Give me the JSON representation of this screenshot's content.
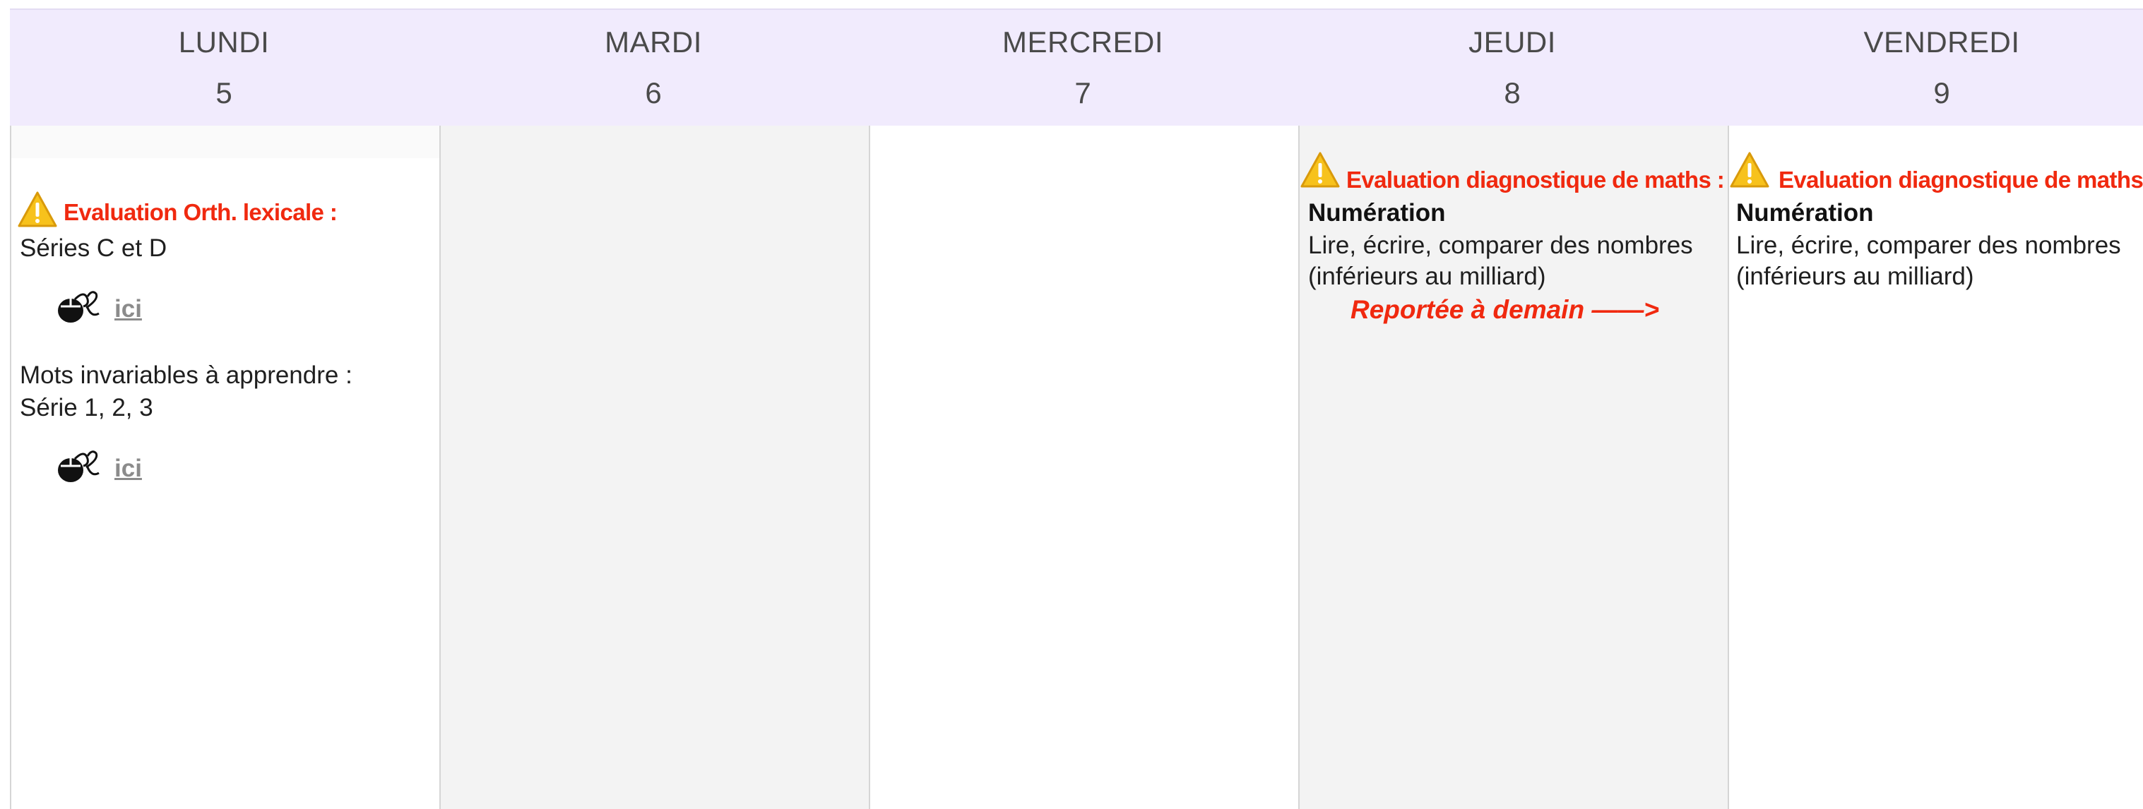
{
  "days": [
    {
      "name": "LUNDI",
      "num": "5"
    },
    {
      "name": "MARDI",
      "num": "6"
    },
    {
      "name": "MERCREDI",
      "num": "7"
    },
    {
      "name": "JEUDI",
      "num": "8"
    },
    {
      "name": "VENDREDI",
      "num": "9"
    }
  ],
  "lundi": {
    "event_title": "Evaluation Orth. lexicale :",
    "series_text": "Séries C et D",
    "link1": "ici",
    "mots_line1": "Mots invariables à apprendre :",
    "mots_line2": "Série 1, 2, 3",
    "link2": "ici",
    "icon_warning": "warning-icon",
    "icon_mouse": "mouse-icon"
  },
  "jeudi": {
    "event_title": "Evaluation diagnostique de maths :",
    "subject": "Numération",
    "line1": "Lire, écrire, comparer des nombres",
    "line2": "(inférieurs au milliard)",
    "reported": "Reportée à demain ——>"
  },
  "vendredi": {
    "event_title": "Evaluation diagnostique de maths :",
    "subject": "Numération",
    "line1": "Lire, écrire, comparer des nombres",
    "line2": "(inférieurs au milliard)"
  },
  "colors": {
    "header_bg": "#f1ebfd",
    "event_red": "#f0290f",
    "link_grey": "#8b8b8b",
    "column_grey": "#f3f3f3"
  }
}
